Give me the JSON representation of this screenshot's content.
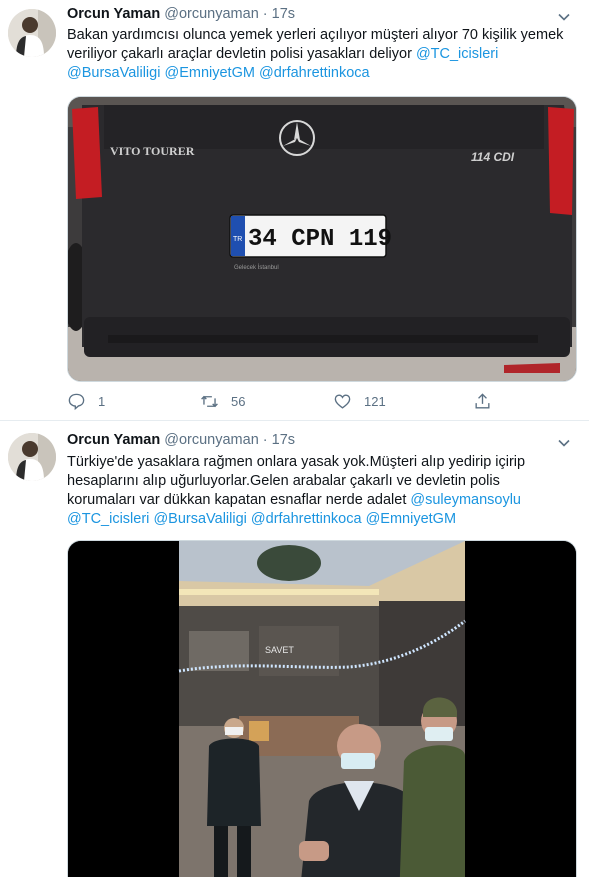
{
  "tweets": [
    {
      "author": {
        "name": "Orcun Yaman",
        "handle": "@orcunyaman",
        "separator": "·",
        "time": "17s"
      },
      "text_lines": [
        "Bakan yardımcısı  olunca yemek yerleri açılıyor müşteri alıyor 70 kişilik yemek",
        "veriliyor çakarlı araçlar devletin polisi yasakları deliyor "
      ],
      "mentions_line1": "@TC_icisleri",
      "mentions_line2": [
        "@BursaValiligi",
        "@EmniyetGM",
        "@drfahrettinkoca"
      ],
      "photo": {
        "badge_left": "VITO TOURER",
        "badge_right": "114 CDI",
        "plate_country": "TR",
        "plate": "34 CPN 119",
        "plate_dealer": "Gelecek İstanbul"
      },
      "actions": {
        "reply_count": "1",
        "retweet_count": "56",
        "like_count": "121"
      }
    },
    {
      "author": {
        "name": "Orcun Yaman",
        "handle": "@orcunyaman",
        "separator": "·",
        "time": "17s"
      },
      "text_lines": [
        "Türkiye'de yasaklara rağmen onlara yasak yok.Müşteri  alıp yedirip içirip",
        "hesaplarını alıp uğurluyorlar.Gelen arabalar çakarlı ve devletin polis",
        "korumaları var dükkan kapatan esnaflar nerde adalet "
      ],
      "mentions_line3": "@suleymansoylu",
      "mentions_line4": [
        "@TC_icisleri",
        "@BursaValiligi",
        "@drfahrettinkoca",
        "@EmniyetGM"
      ],
      "video": {
        "store_sign": "SAVET"
      }
    }
  ],
  "colors": {
    "link": "#1b95e0",
    "secondary": "#5b7083",
    "divider": "#e6ecf0"
  }
}
